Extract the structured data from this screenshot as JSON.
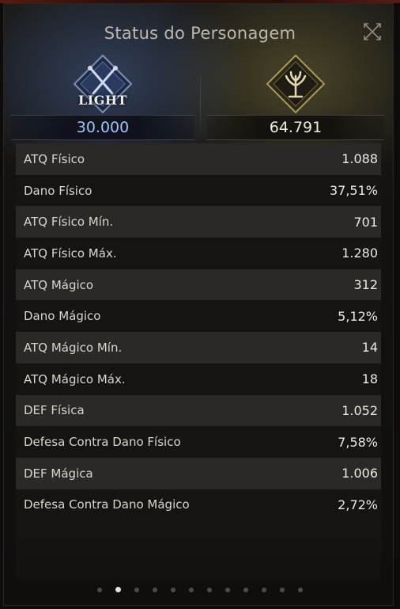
{
  "window": {
    "title": "Status do Personagem",
    "close_icon": "close-icon"
  },
  "header": {
    "left": {
      "emblem_text": "LIGHT",
      "value": "30.000",
      "icon": "crossed-swords-emblem-icon",
      "accent": "#9cc2ff"
    },
    "right": {
      "value": "64.791",
      "icon": "tree-emblem-icon",
      "accent": "#d8c77a"
    }
  },
  "stats": [
    {
      "label": "ATQ Físico",
      "value": "1.088"
    },
    {
      "label": "Dano Físico",
      "value": "37,51%"
    },
    {
      "label": "ATQ Físico Mín.",
      "value": "701"
    },
    {
      "label": "ATQ Físico Máx.",
      "value": "1.280"
    },
    {
      "label": "ATQ Mágico",
      "value": "312"
    },
    {
      "label": "Dano Mágico",
      "value": "5,12%"
    },
    {
      "label": "ATQ Mágico Mín.",
      "value": "14"
    },
    {
      "label": "ATQ Mágico Máx.",
      "value": "18"
    },
    {
      "label": "DEF Física",
      "value": "1.052"
    },
    {
      "label": "Defesa Contra Dano Físico",
      "value": "7,58%"
    },
    {
      "label": "DEF Mágica",
      "value": "1.006"
    },
    {
      "label": "Defesa Contra Dano Mágico",
      "value": "2,72%"
    }
  ],
  "pagination": {
    "total": 12,
    "active_index": 1
  }
}
